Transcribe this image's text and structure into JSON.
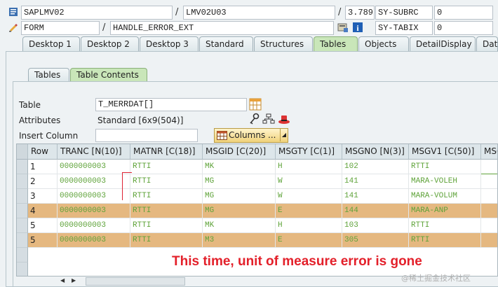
{
  "header": {
    "row1": {
      "field1": "SAPLMV02",
      "field2": "LMV02U03",
      "field3": "3.789",
      "field4": "SY-SUBRC",
      "field5": "0"
    },
    "row2": {
      "field1": "FORM",
      "field2": "HANDLE_ERROR_EXT",
      "field4": "SY-TABIX",
      "field5": "0"
    }
  },
  "tabs": [
    {
      "label": "Desktop 1"
    },
    {
      "label": "Desktop 2"
    },
    {
      "label": "Desktop 3"
    },
    {
      "label": "Standard"
    },
    {
      "label": "Structures"
    },
    {
      "label": "Tables"
    },
    {
      "label": "Objects"
    },
    {
      "label": "DetailDisplay"
    },
    {
      "label": "Data"
    }
  ],
  "subtabs": [
    {
      "label": "Tables"
    },
    {
      "label": "Table Contents"
    }
  ],
  "form": {
    "table_label": "Table",
    "table_value": "T_MERRDAT[]",
    "attributes_label": "Attributes",
    "attributes_value": "Standard [6x9(504)]",
    "insert_column_label": "Insert Column",
    "insert_column_value": "",
    "columns_button": "Columns ..."
  },
  "grid": {
    "columns": [
      "Row",
      "TRANC [N(10)]",
      "MATNR [C(18)]",
      "MSGID [C(20)]",
      "MSGTY [C(1)]",
      "MSGNO [N(3)]",
      "MSGV1 [C(50)]",
      "MSG"
    ],
    "rows": [
      {
        "row": "1",
        "tranc": "0000000003",
        "matnr": "RTTI",
        "msgid": "MK",
        "msgty": "H",
        "msgno": "102",
        "msgv1": "RTTI",
        "highlight": false
      },
      {
        "row": "2",
        "tranc": "0000000003",
        "matnr": "RTTI",
        "msgid": "MG",
        "msgty": "W",
        "msgno": "141",
        "msgv1": "MARA-VOLEH",
        "highlight": false
      },
      {
        "row": "3",
        "tranc": "0000000003",
        "matnr": "RTTI",
        "msgid": "MG",
        "msgty": "W",
        "msgno": "141",
        "msgv1": "MARA-VOLUM",
        "highlight": false
      },
      {
        "row": "4",
        "tranc": "0000000003",
        "matnr": "RTTI",
        "msgid": "MG",
        "msgty": "E",
        "msgno": "144",
        "msgv1": "MARA-ANP",
        "highlight": true
      },
      {
        "row": "5",
        "tranc": "0000000003",
        "matnr": "RTTI",
        "msgid": "MK",
        "msgty": "H",
        "msgno": "103",
        "msgv1": "RTTI",
        "highlight": false
      },
      {
        "row": "5",
        "tranc": "0000000003",
        "matnr": "RTTI",
        "msgid": "M3",
        "msgty": "E",
        "msgno": "305",
        "msgv1": "RTTI",
        "highlight": true
      }
    ]
  },
  "annotation": "This time, unit of measure error is gone",
  "watermark": "@稀土掘金技术社区",
  "colors": {
    "active_tab": "#c9e6b9",
    "highlight_row": "#e5b880",
    "cell_text": "#5fa33a",
    "annotation": "#e3202a"
  }
}
